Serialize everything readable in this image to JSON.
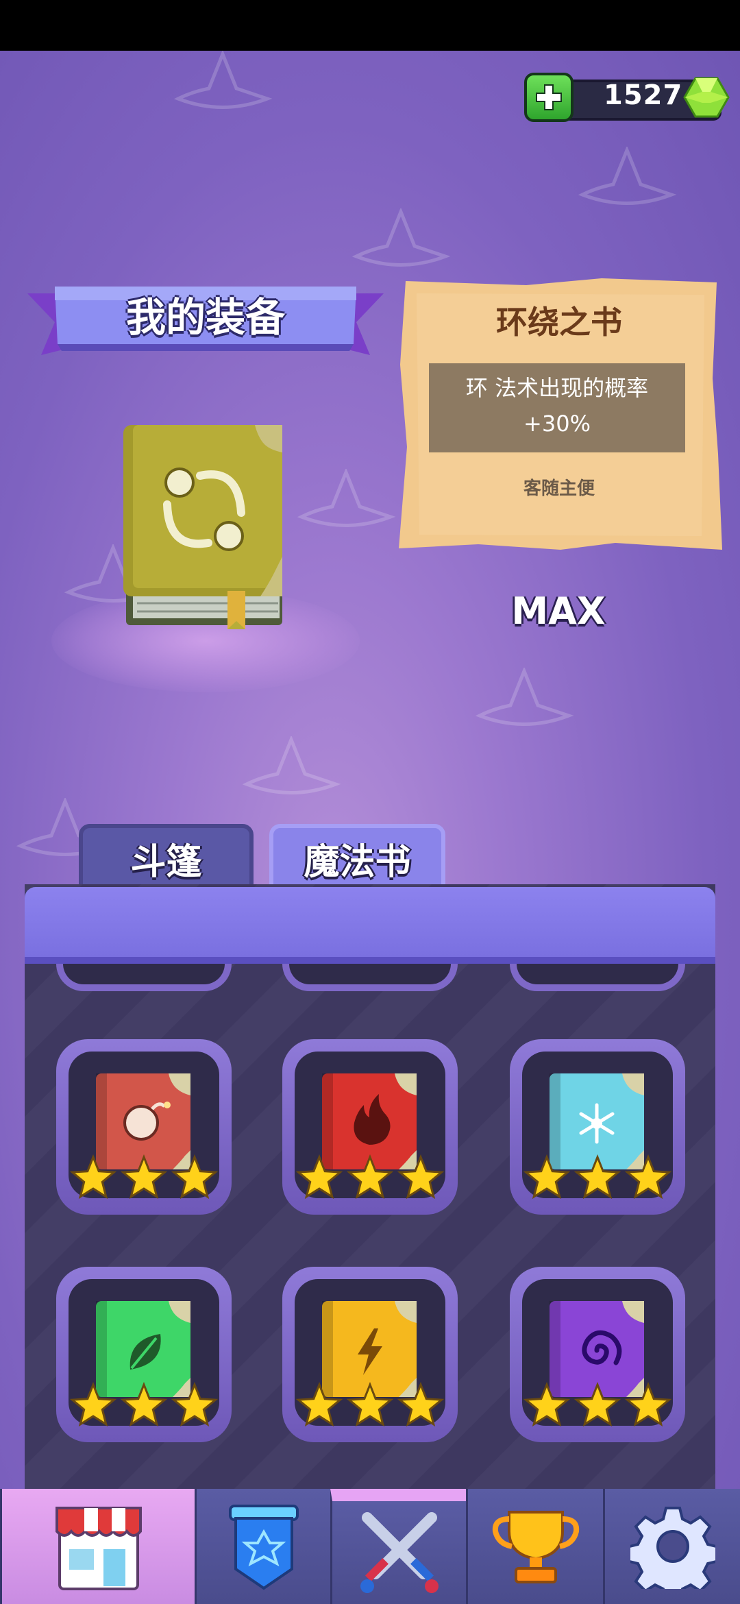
{
  "currency": {
    "amount": "1527",
    "add_icon": "plus-icon",
    "gem_icon": "green-gem-icon"
  },
  "equipment": {
    "title": "我的装备",
    "item_icon": "orbit-book-icon"
  },
  "item_card": {
    "name": "环绕之书",
    "description_line1": "环 法术出现的概率",
    "description_line2": "+30%",
    "tag": "客随主便",
    "level": "MAX"
  },
  "tabs": [
    {
      "label": "斗篷",
      "active": false
    },
    {
      "label": "魔法书",
      "active": true
    }
  ],
  "books": [
    {
      "name": "bomb-book",
      "color": "#d2564a",
      "stars": 3
    },
    {
      "name": "fire-book",
      "color": "#d9332e",
      "stars": 3
    },
    {
      "name": "ice-book",
      "color": "#6fd4e6",
      "stars": 3
    },
    {
      "name": "leaf-book",
      "color": "#3ed668",
      "stars": 3
    },
    {
      "name": "lightning-book",
      "color": "#f5b81e",
      "stars": 3
    },
    {
      "name": "spiral-book",
      "color": "#8a45d6",
      "stars": 3
    }
  ],
  "nav": [
    {
      "icon": "shop-icon",
      "active": true
    },
    {
      "icon": "shield-icon",
      "active": false
    },
    {
      "icon": "crossed-swords-icon",
      "active": false
    },
    {
      "icon": "trophy-icon",
      "active": false
    },
    {
      "icon": "settings-gear-icon",
      "active": false
    }
  ],
  "colors": {
    "accent": "#8a84ea",
    "background": "#7e62c0",
    "star": "#ffd21a"
  }
}
